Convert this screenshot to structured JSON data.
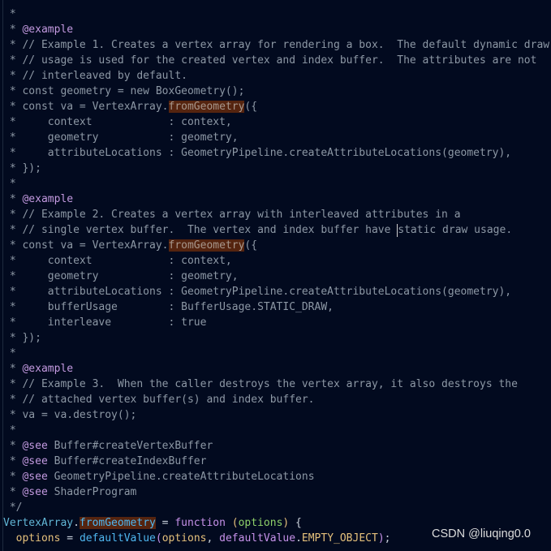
{
  "editor": {
    "lines": [
      [
        {
          "t": " *",
          "c": "cm"
        }
      ],
      [
        {
          "t": " * ",
          "c": "cm"
        },
        {
          "t": "@example",
          "c": "tag"
        }
      ],
      [
        {
          "t": " * // Example 1. Creates a vertex array for rendering a box.  The default dynamic draw",
          "c": "cm"
        }
      ],
      [
        {
          "t": " * // usage is used for the created vertex and index buffer.  The attributes are not",
          "c": "cm"
        }
      ],
      [
        {
          "t": " * // interleaved by default.",
          "c": "cm"
        }
      ],
      [
        {
          "t": " * const geometry = new BoxGeometry();",
          "c": "cm"
        }
      ],
      [
        {
          "t": " * const va = VertexArray.",
          "c": "cm"
        },
        {
          "t": "fromGeometry",
          "c": "hlc"
        },
        {
          "t": "({",
          "c": "cm"
        }
      ],
      [
        {
          "t": " *     context            : context,",
          "c": "cm"
        }
      ],
      [
        {
          "t": " *     geometry           : geometry,",
          "c": "cm"
        }
      ],
      [
        {
          "t": " *     attributeLocations : GeometryPipeline.createAttributeLocations(geometry),",
          "c": "cm"
        }
      ],
      [
        {
          "t": " * });",
          "c": "cm"
        }
      ],
      [
        {
          "t": " *",
          "c": "cm"
        }
      ],
      [
        {
          "t": " * ",
          "c": "cm"
        },
        {
          "t": "@example",
          "c": "tag"
        }
      ],
      [
        {
          "t": " * // Example 2. Creates a vertex array with interleaved attributes in a",
          "c": "cm"
        }
      ],
      [
        {
          "t": " * // single vertex buffer.  The vertex and index buffer have ",
          "c": "cm"
        },
        {
          "t": "",
          "c": "cursor"
        },
        {
          "t": "static draw usage.",
          "c": "cm"
        }
      ],
      [
        {
          "t": " * const va = VertexArray.",
          "c": "cm"
        },
        {
          "t": "fromGeometry",
          "c": "hlc"
        },
        {
          "t": "({",
          "c": "cm"
        }
      ],
      [
        {
          "t": " *     context            : context,",
          "c": "cm"
        }
      ],
      [
        {
          "t": " *     geometry           : geometry,",
          "c": "cm"
        }
      ],
      [
        {
          "t": " *     attributeLocations : GeometryPipeline.createAttributeLocations(geometry),",
          "c": "cm"
        }
      ],
      [
        {
          "t": " *     bufferUsage        : BufferUsage.STATIC_DRAW,",
          "c": "cm"
        }
      ],
      [
        {
          "t": " *     interleave         : true",
          "c": "cm"
        }
      ],
      [
        {
          "t": " * });",
          "c": "cm"
        }
      ],
      [
        {
          "t": " *",
          "c": "cm"
        }
      ],
      [
        {
          "t": " * ",
          "c": "cm"
        },
        {
          "t": "@example",
          "c": "tag"
        }
      ],
      [
        {
          "t": " * // Example 3.  When the caller destroys the vertex array, it also destroys the",
          "c": "cm"
        }
      ],
      [
        {
          "t": " * // attached vertex buffer(s) and index buffer.",
          "c": "cm"
        }
      ],
      [
        {
          "t": " * va = va.destroy();",
          "c": "cm"
        }
      ],
      [
        {
          "t": " *",
          "c": "cm"
        }
      ],
      [
        {
          "t": " * ",
          "c": "cm"
        },
        {
          "t": "@see",
          "c": "tag"
        },
        {
          "t": " Buffer#createVertexBuffer",
          "c": "cm"
        }
      ],
      [
        {
          "t": " * ",
          "c": "cm"
        },
        {
          "t": "@see",
          "c": "tag"
        },
        {
          "t": " Buffer#createIndexBuffer",
          "c": "cm"
        }
      ],
      [
        {
          "t": " * ",
          "c": "cm"
        },
        {
          "t": "@see",
          "c": "tag"
        },
        {
          "t": " GeometryPipeline.createAttributeLocations",
          "c": "cm"
        }
      ],
      [
        {
          "t": " * ",
          "c": "cm"
        },
        {
          "t": "@see",
          "c": "tag"
        },
        {
          "t": " ShaderProgram",
          "c": "cm"
        }
      ],
      [
        {
          "t": " */",
          "c": "cm"
        }
      ],
      [
        {
          "t": "VertexArray",
          "c": "cls"
        },
        {
          "t": ".",
          "c": "pun"
        },
        {
          "t": "fromGeometry",
          "c": "fn hl"
        },
        {
          "t": " = ",
          "c": "op"
        },
        {
          "t": "function",
          "c": "kw"
        },
        {
          "t": " ",
          "c": "op"
        },
        {
          "t": "(",
          "c": "br"
        },
        {
          "t": "options",
          "c": "par"
        },
        {
          "t": ")",
          "c": "br"
        },
        {
          "t": " {",
          "c": "op"
        }
      ],
      [
        {
          "t": "  options",
          "c": "var"
        },
        {
          "t": " = ",
          "c": "op"
        },
        {
          "t": "defaultValue",
          "c": "fn"
        },
        {
          "t": "(",
          "c": "kw"
        },
        {
          "t": "options",
          "c": "var"
        },
        {
          "t": ", ",
          "c": "op"
        },
        {
          "t": "defaultValue",
          "c": "kw"
        },
        {
          "t": ".",
          "c": "op"
        },
        {
          "t": "EMPTY_OBJECT",
          "c": "var"
        },
        {
          "t": ")",
          "c": "kw"
        },
        {
          "t": ";",
          "c": "op"
        }
      ]
    ]
  },
  "watermark": "CSDN @liuqing0.0",
  "colors": {
    "background": "#020a1f",
    "comment": "#8d98a5",
    "jsdoc_tag": "#c39ae0",
    "highlight": "#55240f"
  }
}
